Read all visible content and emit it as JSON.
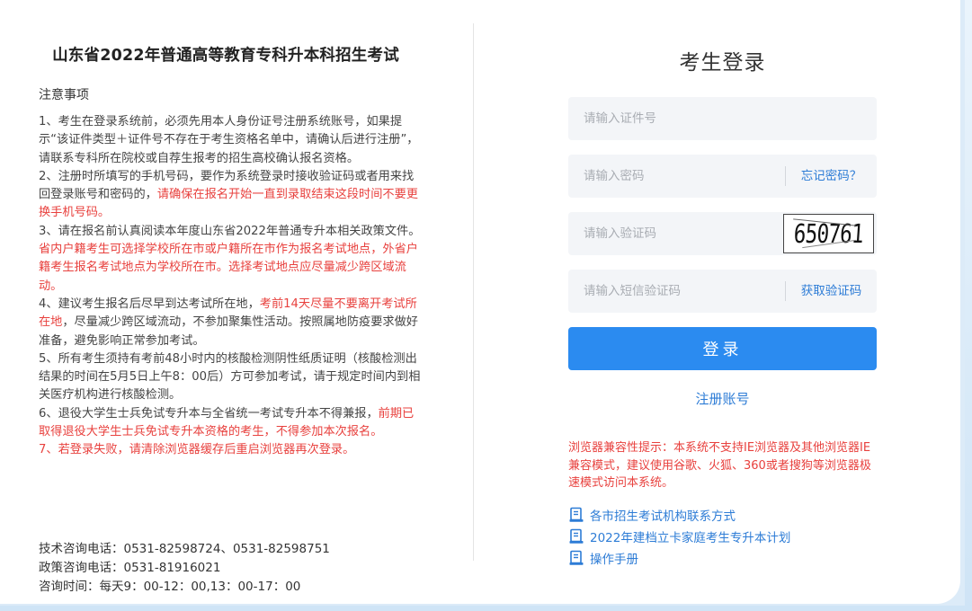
{
  "left": {
    "title": "山东省2022年普通高等教育专科升本科招生考试",
    "notice_heading": "注意事项",
    "notices": [
      [
        {
          "t": "1、考生在登录系统前，必须先用本人身份证号注册系统账号，如果提示“该证件类型＋证件号不存在于考生资格名单中，请确认后进行注册”，请联系专科所在院校或自荐生报考的招生高校确认报名资格。",
          "red": false
        }
      ],
      [
        {
          "t": "2、注册时所填写的手机号码，要作为系统登录时接收验证码或者用来找回登录账号和密码的，",
          "red": false
        },
        {
          "t": "请确保在报名开始一直到录取结束这段时间不要更换手机号码。",
          "red": true
        }
      ],
      [
        {
          "t": "3、请在报名前认真阅读本年度山东省2022年普通专升本相关政策文件。 ",
          "red": false
        },
        {
          "t": "省内户籍考生可选择学校所在市或户籍所在市作为报名考试地点，外省户籍考生报名考试地点为学校所在市。选择考试地点应尽量减少跨区域流动。",
          "red": true
        }
      ],
      [
        {
          "t": "4、建议考生报名后尽早到达考试所在地，",
          "red": false
        },
        {
          "t": "考前14天尽量不要离开考试所在地",
          "red": true
        },
        {
          "t": "，尽量减少跨区域流动，不参加聚集性活动。按照属地防疫要求做好准备，避免影响正常参加考试。",
          "red": false
        }
      ],
      [
        {
          "t": "5、所有考生须持有考前48小时内的核酸检测阴性纸质证明（核酸检测出结果的时间在5月5日上午8：00后）方可参加考试，请于规定时间内到相关医疗机构进行核酸检测。",
          "red": false
        }
      ],
      [
        {
          "t": "6、退役大学生士兵免试专升本与全省统一考试专升本不得兼报，",
          "red": false
        },
        {
          "t": "前期已取得退役大学生士兵免试专升本资格的考生，不得参加本次报名。",
          "red": true
        }
      ],
      [
        {
          "t": "7、若登录失败，请清除浏览器缓存后重启浏览器再次登录。",
          "red": true
        }
      ]
    ],
    "contact": {
      "tech": "技术咨询电话：0531-82598724、0531-82598751",
      "policy": "政策咨询电话：0531-81916021",
      "hours": "咨询时间：每天9：00-12：00,13：00-17：00"
    }
  },
  "login": {
    "title": "考生登录",
    "id_placeholder": "请输入证件号",
    "password_placeholder": "请输入密码",
    "forgot_password": "忘记密码？",
    "captcha_placeholder": "请输入验证码",
    "captcha_text": "650761",
    "sms_placeholder": "请输入短信验证码",
    "get_sms_code": "获取验证码",
    "submit": "登录",
    "register": "注册账号",
    "compat_notice": "浏览器兼容性提示：本系统不支持IE浏览器及其他浏览器IE兼容模式，建议使用谷歌、火狐、360或者搜狗等浏览器极速模式访问本系统。"
  },
  "links": [
    {
      "label": "各市招生考试机构联系方式",
      "icon": "document-icon"
    },
    {
      "label": "2022年建档立卡家庭考生专升本计划",
      "icon": "document-icon"
    },
    {
      "label": "操作手册",
      "icon": "document-icon"
    }
  ],
  "colors": {
    "accent": "#2b8bf0",
    "link": "#2d7cd6",
    "warning": "#e8413e",
    "background": "#dcebf8"
  }
}
